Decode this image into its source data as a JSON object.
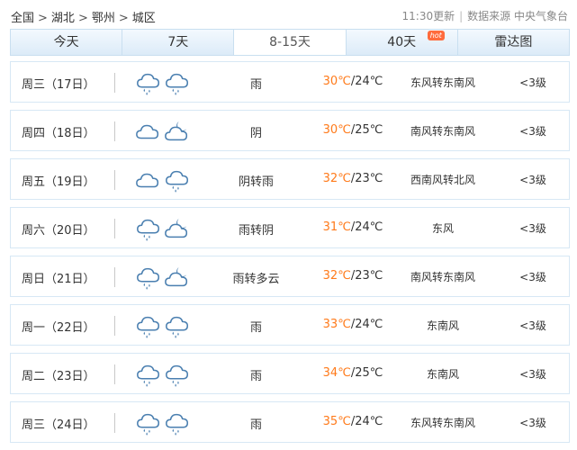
{
  "breadcrumb": {
    "items": [
      "全国",
      "湖北",
      "鄂州",
      "城区"
    ],
    "sep": ">"
  },
  "meta": {
    "updated": "11:30更新",
    "source": "数据来源 中央气象台"
  },
  "tabs": [
    {
      "label": "今天"
    },
    {
      "label": "7天"
    },
    {
      "label": "8-15天",
      "active": true
    },
    {
      "label": "40天",
      "badge": "hot"
    },
    {
      "label": "雷达图"
    }
  ],
  "days": [
    {
      "day": "周三（17日）",
      "icons": [
        "rain-icon",
        "rain-icon"
      ],
      "cond": "雨",
      "hi": "30℃",
      "lo": "/24℃",
      "wind": "东风转东南风",
      "level": "<3级"
    },
    {
      "day": "周四（18日）",
      "icons": [
        "cloudy-icon",
        "partly-cloudy-night-icon"
      ],
      "cond": "阴",
      "hi": "30℃",
      "lo": "/25℃",
      "wind": "南风转东南风",
      "level": "<3级"
    },
    {
      "day": "周五（19日）",
      "icons": [
        "cloudy-icon",
        "rain-icon"
      ],
      "cond": "阴转雨",
      "hi": "32℃",
      "lo": "/23℃",
      "wind": "西南风转北风",
      "level": "<3级"
    },
    {
      "day": "周六（20日）",
      "icons": [
        "rain-icon",
        "partly-cloudy-night-icon"
      ],
      "cond": "雨转阴",
      "hi": "31℃",
      "lo": "/24℃",
      "wind": "东风",
      "level": "<3级"
    },
    {
      "day": "周日（21日）",
      "icons": [
        "rain-icon",
        "partly-cloudy-night-icon"
      ],
      "cond": "雨转多云",
      "hi": "32℃",
      "lo": "/23℃",
      "wind": "南风转东南风",
      "level": "<3级"
    },
    {
      "day": "周一（22日）",
      "icons": [
        "rain-icon",
        "rain-icon"
      ],
      "cond": "雨",
      "hi": "33℃",
      "lo": "/24℃",
      "wind": "东南风",
      "level": "<3级"
    },
    {
      "day": "周二（23日）",
      "icons": [
        "rain-icon",
        "rain-icon"
      ],
      "cond": "雨",
      "hi": "34℃",
      "lo": "/25℃",
      "wind": "东南风",
      "level": "<3级"
    },
    {
      "day": "周三（24日）",
      "icons": [
        "rain-icon",
        "rain-icon"
      ],
      "cond": "雨",
      "hi": "35℃",
      "lo": "/24℃",
      "wind": "东风转东南风",
      "level": "<3级"
    }
  ],
  "colors": {
    "accent": "#4a7fb0",
    "hi_temp": "#ff7a1a",
    "border": "#d7e8f5"
  }
}
